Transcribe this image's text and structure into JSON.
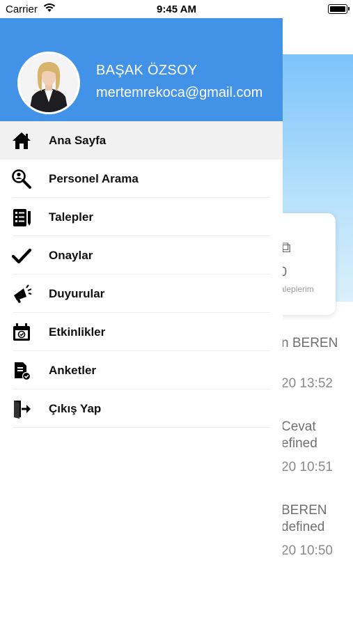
{
  "status_bar": {
    "carrier": "Carrier",
    "time": "9:45 AM"
  },
  "background": {
    "card": {
      "count": "0",
      "label": "aleplerim"
    },
    "lines": [
      "n BEREN",
      "20 13:52",
      "Cevat",
      "efined",
      "20 10:51",
      "BEREN",
      "defined",
      "20 10:50"
    ]
  },
  "profile": {
    "name": "BAŞAK ÖZSOY",
    "email": "mertemrekoca@gmail.com"
  },
  "menu": {
    "items": [
      {
        "label": "Ana Sayfa",
        "icon": "home-icon",
        "active": true
      },
      {
        "label": "Personel Arama",
        "icon": "search-person-icon"
      },
      {
        "label": "Talepler",
        "icon": "checklist-icon"
      },
      {
        "label": "Onaylar",
        "icon": "checkmark-icon"
      },
      {
        "label": "Duyurular",
        "icon": "megaphone-icon"
      },
      {
        "label": "Etkinlikler",
        "icon": "calendar-icon"
      },
      {
        "label": "Anketler",
        "icon": "survey-icon"
      },
      {
        "label": "Çıkış Yap",
        "icon": "logout-icon"
      }
    ]
  },
  "colors": {
    "header": "#4293e8",
    "active_row": "#f1f1f1"
  }
}
